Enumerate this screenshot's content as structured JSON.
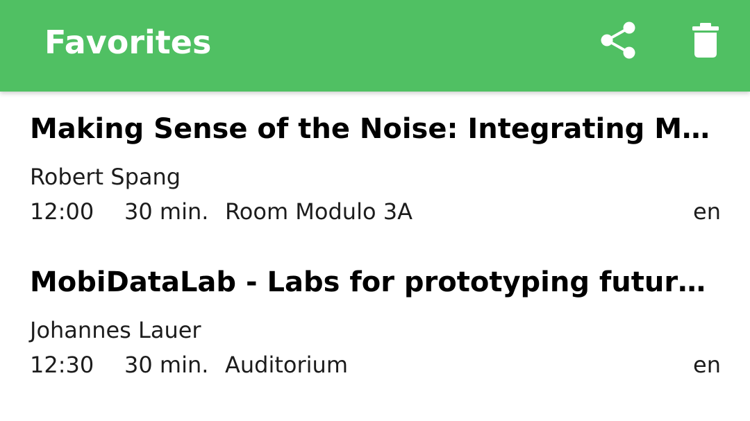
{
  "appbar": {
    "title": "Favorites",
    "background_color": "#50c063",
    "actions": [
      {
        "icon": "share-icon"
      },
      {
        "icon": "delete-icon"
      }
    ]
  },
  "sessions": [
    {
      "title": "Making Sense of the Noise: Integrating M…",
      "speaker": "Robert Spang",
      "time": "12:00",
      "duration": "30 min.",
      "room": "Room Modulo 3A",
      "language": "en"
    },
    {
      "title": "MobiDataLab - Labs for prototyping futur…",
      "speaker": "Johannes Lauer",
      "time": "12:30",
      "duration": "30 min.",
      "room": "Auditorium",
      "language": "en"
    }
  ]
}
